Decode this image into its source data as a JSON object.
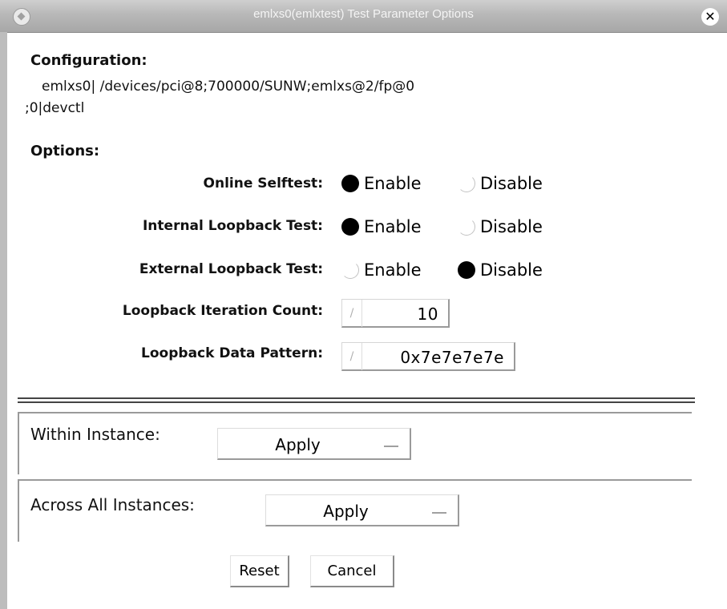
{
  "window": {
    "title": "emlxs0(emlxtest) Test Parameter Options",
    "menu_icon": "window-menu-icon",
    "close_icon": "close-icon"
  },
  "configuration": {
    "heading": "Configuration:",
    "line1": "emlxs0| /devices/pci@8;700000/SUNW;emlxs@2/fp@0",
    "line2": ";0|devctl"
  },
  "options": {
    "heading": "Options:",
    "online_selftest": {
      "label": "Online Selftest:",
      "enable_label": "Enable",
      "disable_label": "Disable",
      "selected": "Enable"
    },
    "internal_loopback": {
      "label": "Internal Loopback Test:",
      "enable_label": "Enable",
      "disable_label": "Disable",
      "selected": "Enable"
    },
    "external_loopback": {
      "label": "External Loopback Test:",
      "enable_label": "Enable",
      "disable_label": "Disable",
      "selected": "Disable"
    },
    "iteration_count": {
      "label": "Loopback Iteration Count:",
      "value": "10"
    },
    "data_pattern": {
      "label": "Loopback Data Pattern:",
      "value": "0x7e7e7e7e"
    }
  },
  "within_instance": {
    "label": "Within Instance:",
    "button_label": "Apply"
  },
  "across_instances": {
    "label": "Across All Instances:",
    "button_label": "Apply"
  },
  "buttons": {
    "reset": "Reset",
    "cancel": "Cancel"
  }
}
